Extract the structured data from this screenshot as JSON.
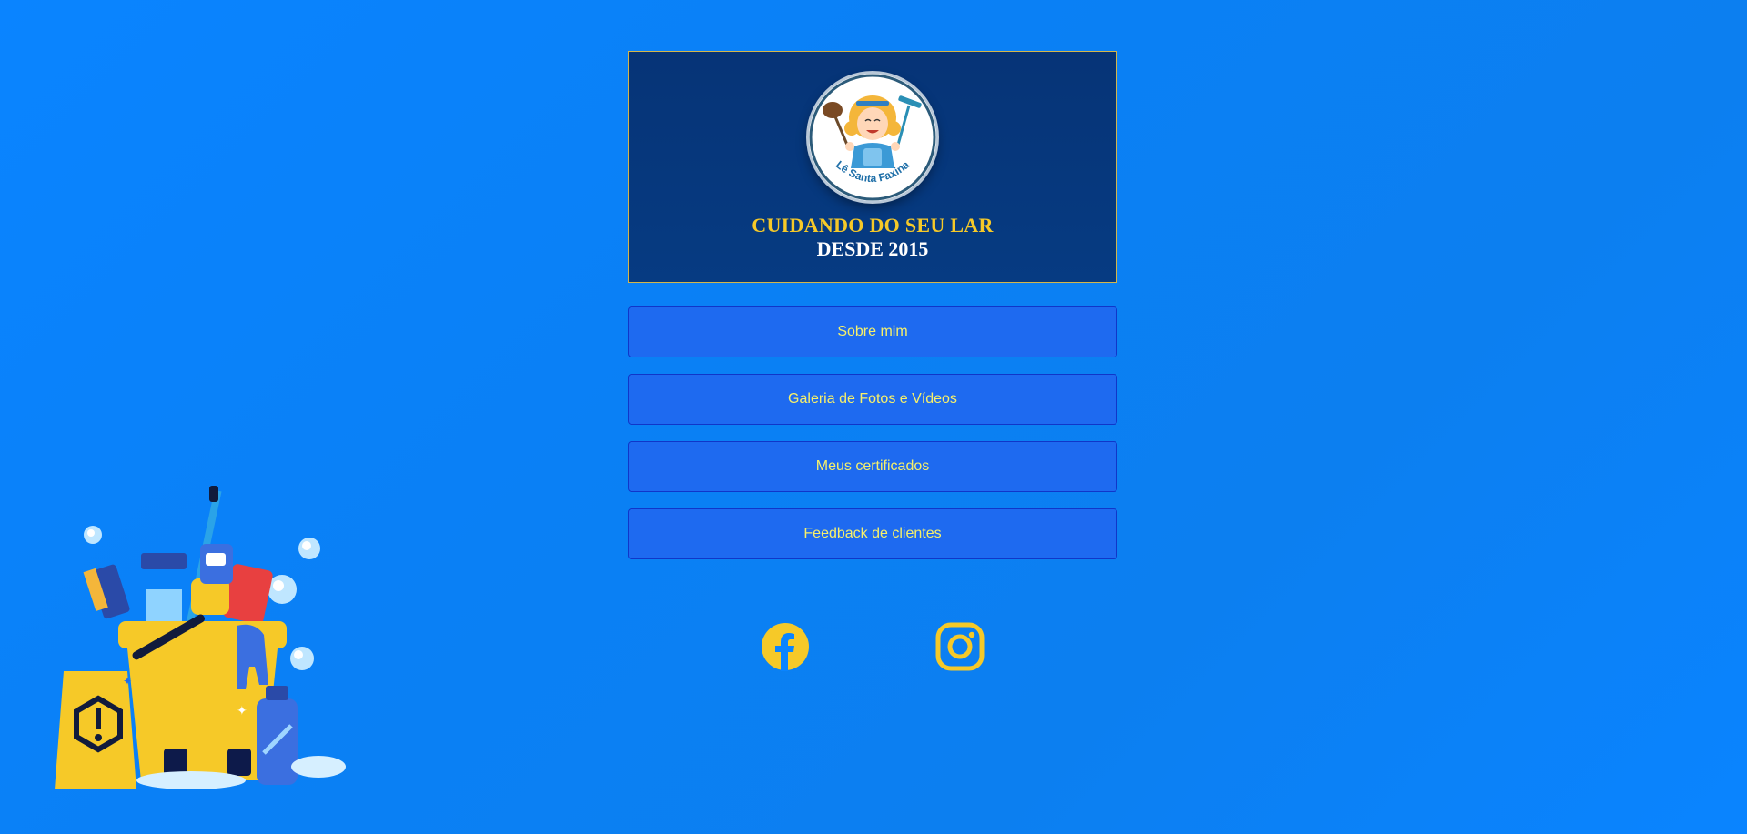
{
  "header": {
    "logo_name": "Lê Santa Faxina",
    "slogan_line1": "CUIDANDO DO SEU LAR",
    "slogan_line2": "DESDE 2015"
  },
  "menu": [
    {
      "label": "Sobre mim"
    },
    {
      "label": "Galeria de Fotos e Vídeos"
    },
    {
      "label": "Meus certificados"
    },
    {
      "label": "Feedback de clientes"
    }
  ],
  "social": [
    {
      "icon": "facebook-icon"
    },
    {
      "icon": "instagram-icon"
    }
  ],
  "colors": {
    "background": "#0a84ff",
    "banner": "#063b82",
    "button": "#1e6af0",
    "button_text": "#f7f06a",
    "accent_yellow": "#f6c928"
  }
}
